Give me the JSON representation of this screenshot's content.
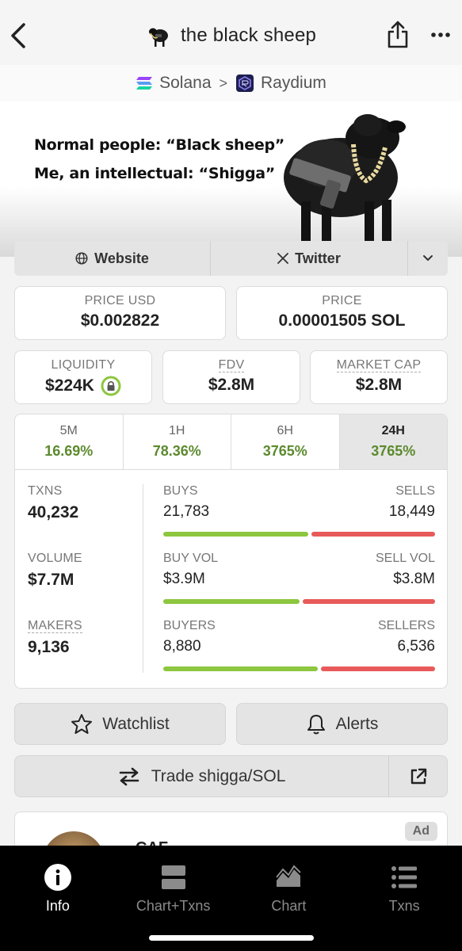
{
  "header": {
    "title": "the black sheep"
  },
  "chainbar": {
    "chain": "Solana",
    "separator": ">",
    "dex": "Raydium"
  },
  "banner": {
    "line1": "Normal people: “Black sheep”",
    "line2": "Me, an intellectual: “Shigga”"
  },
  "links": {
    "website": "Website",
    "twitter": "Twitter"
  },
  "price": {
    "usd_label": "PRICE USD",
    "usd_value": "$0.002822",
    "native_label": "PRICE",
    "native_value": "0.00001505 SOL"
  },
  "metrics": {
    "liquidity_label": "LIQUIDITY",
    "liquidity_value": "$224K",
    "fdv_label": "FDV",
    "fdv_value": "$2.8M",
    "mcap_label": "MARKET CAP",
    "mcap_value": "$2.8M"
  },
  "tabs": [
    {
      "label": "5M",
      "value": "16.69%"
    },
    {
      "label": "1H",
      "value": "78.36%"
    },
    {
      "label": "6H",
      "value": "3765%"
    },
    {
      "label": "24H",
      "value": "3765%"
    }
  ],
  "active_tab": "24H",
  "stats": {
    "txns_label": "TXNS",
    "txns_value": "40,232",
    "volume_label": "VOLUME",
    "volume_value": "$7.7M",
    "makers_label": "MAKERS",
    "makers_value": "9,136",
    "buys_label": "BUYS",
    "buys_value": "21,783",
    "sells_label": "SELLS",
    "sells_value": "18,449",
    "buyvol_label": "BUY VOL",
    "buyvol_value": "$3.9M",
    "sellvol_label": "SELL VOL",
    "sellvol_value": "$3.8M",
    "buyers_label": "BUYERS",
    "buyers_value": "8,880",
    "sellers_label": "SELLERS",
    "sellers_value": "6,536",
    "buys_share": 0.541,
    "buyvol_share": 0.506,
    "buyers_share": 0.576
  },
  "actions": {
    "watchlist": "Watchlist",
    "alerts": "Alerts",
    "trade": "Trade shigga/SOL"
  },
  "ad": {
    "badge": "Ad",
    "name": "CAF"
  },
  "nav": [
    {
      "label": "Info",
      "icon": "info-icon"
    },
    {
      "label": "Chart+Txns",
      "icon": "split-layout-icon"
    },
    {
      "label": "Chart",
      "icon": "chart-icon"
    },
    {
      "label": "Txns",
      "icon": "list-icon"
    }
  ],
  "colors": {
    "green": "#5c8a2e",
    "buy_bar": "#8dc63f",
    "sell_bar": "#e85a5a",
    "nav_bg": "#000000"
  }
}
